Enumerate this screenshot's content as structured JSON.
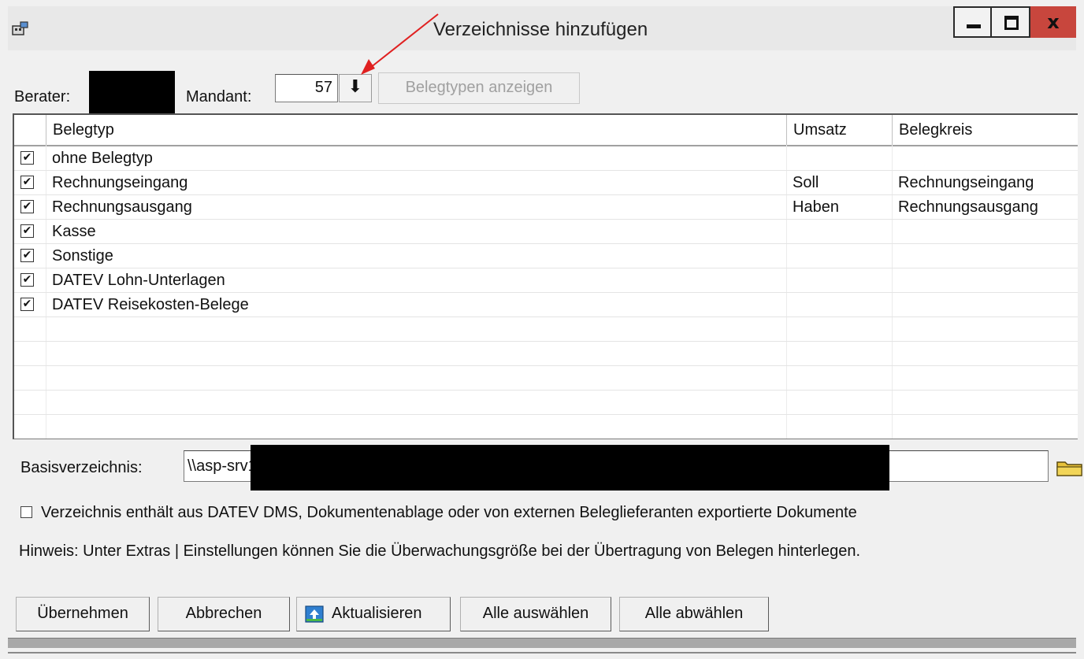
{
  "window": {
    "title": "Verzeichnisse hinzufügen",
    "close_glyph": "x"
  },
  "toolbar": {
    "berater_label": "Berater:",
    "mandant_label": "Mandant:",
    "mandant_value": "57",
    "dropdown_glyph": "⬇",
    "show_types_button": "Belegtypen anzeigen"
  },
  "grid": {
    "columns": [
      "Belegtyp",
      "Umsatz",
      "Belegkreis"
    ],
    "rows": [
      {
        "checked": true,
        "belegtyp": "ohne Belegtyp",
        "umsatz": "",
        "belegkreis": ""
      },
      {
        "checked": true,
        "belegtyp": "Rechnungseingang",
        "umsatz": "Soll",
        "belegkreis": "Rechnungseingang"
      },
      {
        "checked": true,
        "belegtyp": "Rechnungsausgang",
        "umsatz": "Haben",
        "belegkreis": "Rechnungsausgang"
      },
      {
        "checked": true,
        "belegtyp": "Kasse",
        "umsatz": "",
        "belegkreis": ""
      },
      {
        "checked": true,
        "belegtyp": "Sonstige",
        "umsatz": "",
        "belegkreis": ""
      },
      {
        "checked": true,
        "belegtyp": "DATEV Lohn-Unterlagen",
        "umsatz": "",
        "belegkreis": ""
      },
      {
        "checked": true,
        "belegtyp": "DATEV Reisekosten-Belege",
        "umsatz": "",
        "belegkreis": ""
      }
    ],
    "check_glyph": "✔"
  },
  "basis": {
    "label": "Basisverzeichnis:",
    "value": "\\\\asp-srv1"
  },
  "dms_checkbox": {
    "checked": false,
    "label": "Verzeichnis enthält aus DATEV DMS, Dokumentenablage oder von externen Beleglieferanten exportierte Dokumente"
  },
  "hint": "Hinweis: Unter Extras | Einstellungen können Sie die Überwachungsgröße bei der Übertragung von Belegen hinterlegen.",
  "buttons": {
    "apply": "Übernehmen",
    "cancel": "Abbrechen",
    "refresh": "Aktualisieren",
    "select_all": "Alle auswählen",
    "deselect_all": "Alle abwählen"
  },
  "colors": {
    "close_button": "#c8463d",
    "annotation_arrow": "#e02020",
    "window_bg": "#f0f0f0"
  }
}
